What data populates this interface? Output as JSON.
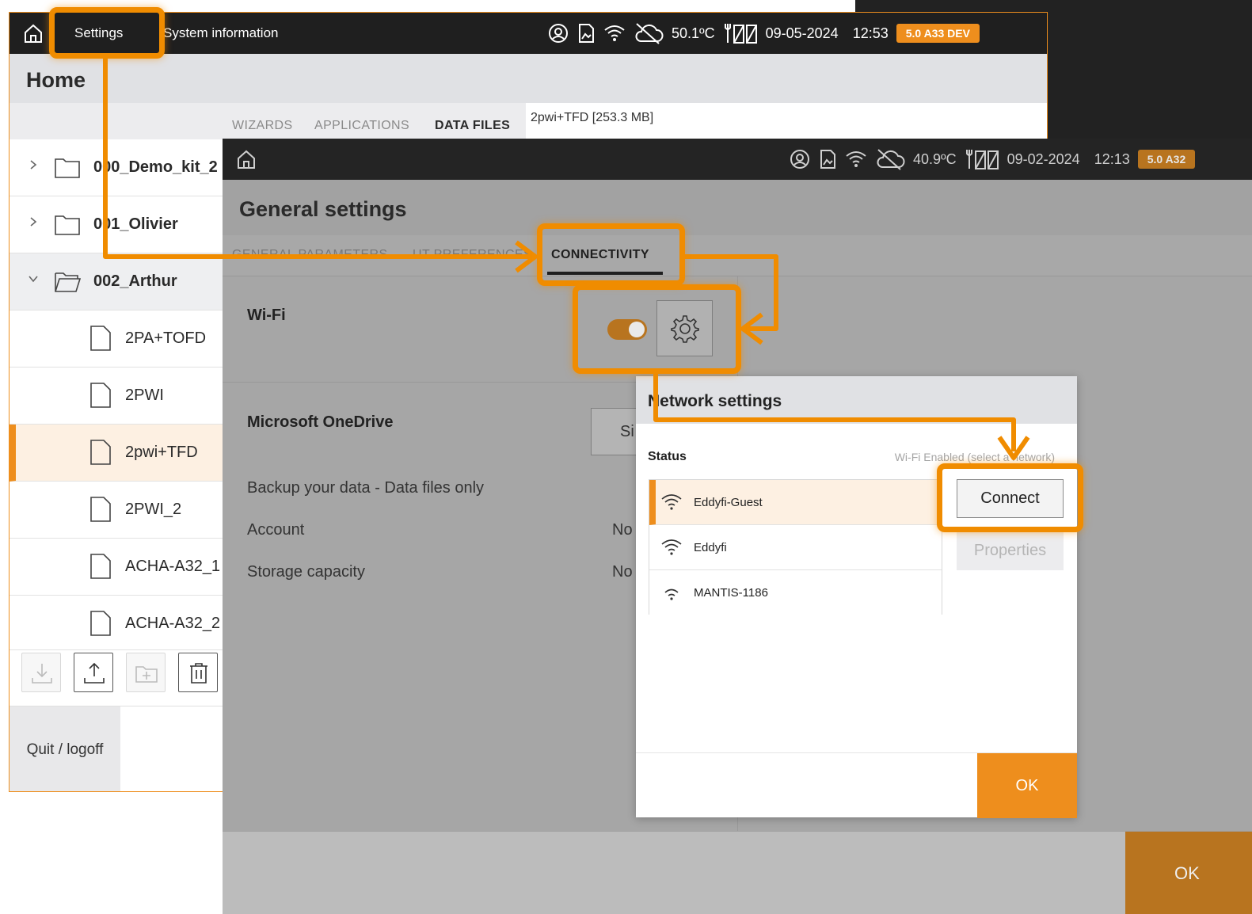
{
  "back_window": {
    "menu": {
      "settings": "Settings",
      "system_info": "System information"
    },
    "status": {
      "temperature": "50.1ºC",
      "date": "09-05-2024",
      "time": "12:53",
      "version": "5.0 A33 DEV"
    },
    "title": "Home",
    "tabs": [
      "WIZARDS",
      "APPLICATIONS",
      "DATA FILES"
    ],
    "preview": "2pwi+TFD [253.3 MB]",
    "tree": [
      {
        "label": "000_Demo_kit_2",
        "type": "folder"
      },
      {
        "label": "001_Olivier",
        "type": "folder"
      },
      {
        "label": "002_Arthur",
        "type": "folder-open"
      },
      {
        "label": "2PA+TOFD",
        "type": "file"
      },
      {
        "label": "2PWI",
        "type": "file"
      },
      {
        "label": "2pwi+TFD",
        "type": "file"
      },
      {
        "label": "2PWI_2",
        "type": "file"
      },
      {
        "label": "ACHA-A32_1",
        "type": "file"
      },
      {
        "label": "ACHA-A32_2",
        "type": "file"
      }
    ],
    "quit": "Quit / logoff"
  },
  "front_window": {
    "status": {
      "temperature": "40.9ºC",
      "date": "09-02-2024",
      "time": "12:13",
      "version": "5.0 A32"
    },
    "title": "General settings",
    "tabs": [
      "GENERAL PARAMETERS",
      "UT PREFERENCES",
      "CONNECTIVITY"
    ],
    "wifi": {
      "label": "Wi-Fi",
      "enabled": true
    },
    "onedrive": {
      "title": "Microsoft OneDrive",
      "sign_in_partial": "Si",
      "backup": "Backup your data - Data files only",
      "account_label": "Account",
      "account_value_partial": "No",
      "storage_label": "Storage capacity",
      "storage_value_partial": "No"
    },
    "ok": "OK"
  },
  "dialog": {
    "title": "Network settings",
    "status_label": "Status",
    "status_value": "Wi-Fi Enabled (select a network)",
    "networks": [
      {
        "name": "Eddyfi-Guest",
        "selected": true
      },
      {
        "name": "Eddyfi",
        "selected": false
      },
      {
        "name": "MANTIS-1186",
        "selected": false
      }
    ],
    "connect": "Connect",
    "properties": "Properties",
    "ok": "OK"
  },
  "colors": {
    "accent": "#ee8e1d",
    "annotation": "#f08c00",
    "topbar": "#1f1f1f"
  }
}
